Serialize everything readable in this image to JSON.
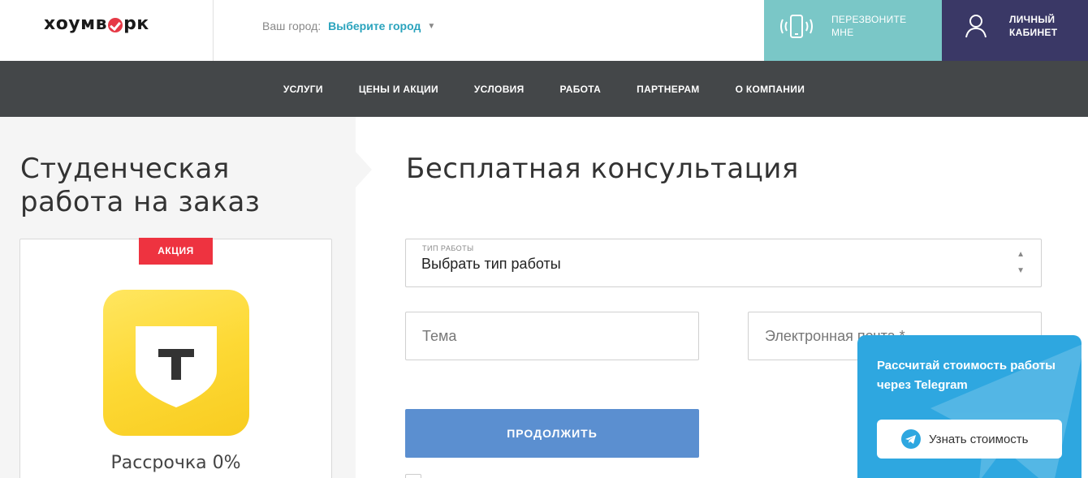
{
  "header": {
    "logo_left": "хоумв",
    "logo_right": "рк",
    "city_label": "Ваш город:",
    "city_value": "Выберите город",
    "city_arrow": "▼",
    "callback_label_1": "ПЕРЕЗВОНИТЕ",
    "callback_label_2": "МНЕ",
    "cabinet_label_1": "ЛИЧНЫЙ",
    "cabinet_label_2": "КАБИНЕТ",
    "callback_color": "#7ac7c7",
    "cabinet_color": "#3a3866"
  },
  "nav": {
    "items": [
      "УСЛУГИ",
      "ЦЕНЫ И АКЦИИ",
      "УСЛОВИЯ",
      "РАБОТА",
      "ПАРТНЕРАМ",
      "О КОМПАНИИ"
    ]
  },
  "left": {
    "title_line1": "Студенческая",
    "title_line2": "работа на заказ",
    "badge": "АКЦИЯ",
    "badge_color": "#ee3340",
    "bank_icon": "tinkoff-logo",
    "bank_letter": "Т",
    "promo_text": "Рассрочка 0%"
  },
  "form": {
    "title": "Бесплатная консультация",
    "select_label": "ТИП РАБОТЫ",
    "select_value": "Выбрать тип работы",
    "topic_placeholder": "Тема",
    "email_placeholder": "Электронная почта *",
    "continue_label": "ПРОДОЛЖИТЬ",
    "button_color": "#5b8fd0"
  },
  "telegram": {
    "text": "Рассчитай стоимость работы через Telegram",
    "button_label": "Узнать стоимость",
    "color": "#2ea7e0"
  }
}
